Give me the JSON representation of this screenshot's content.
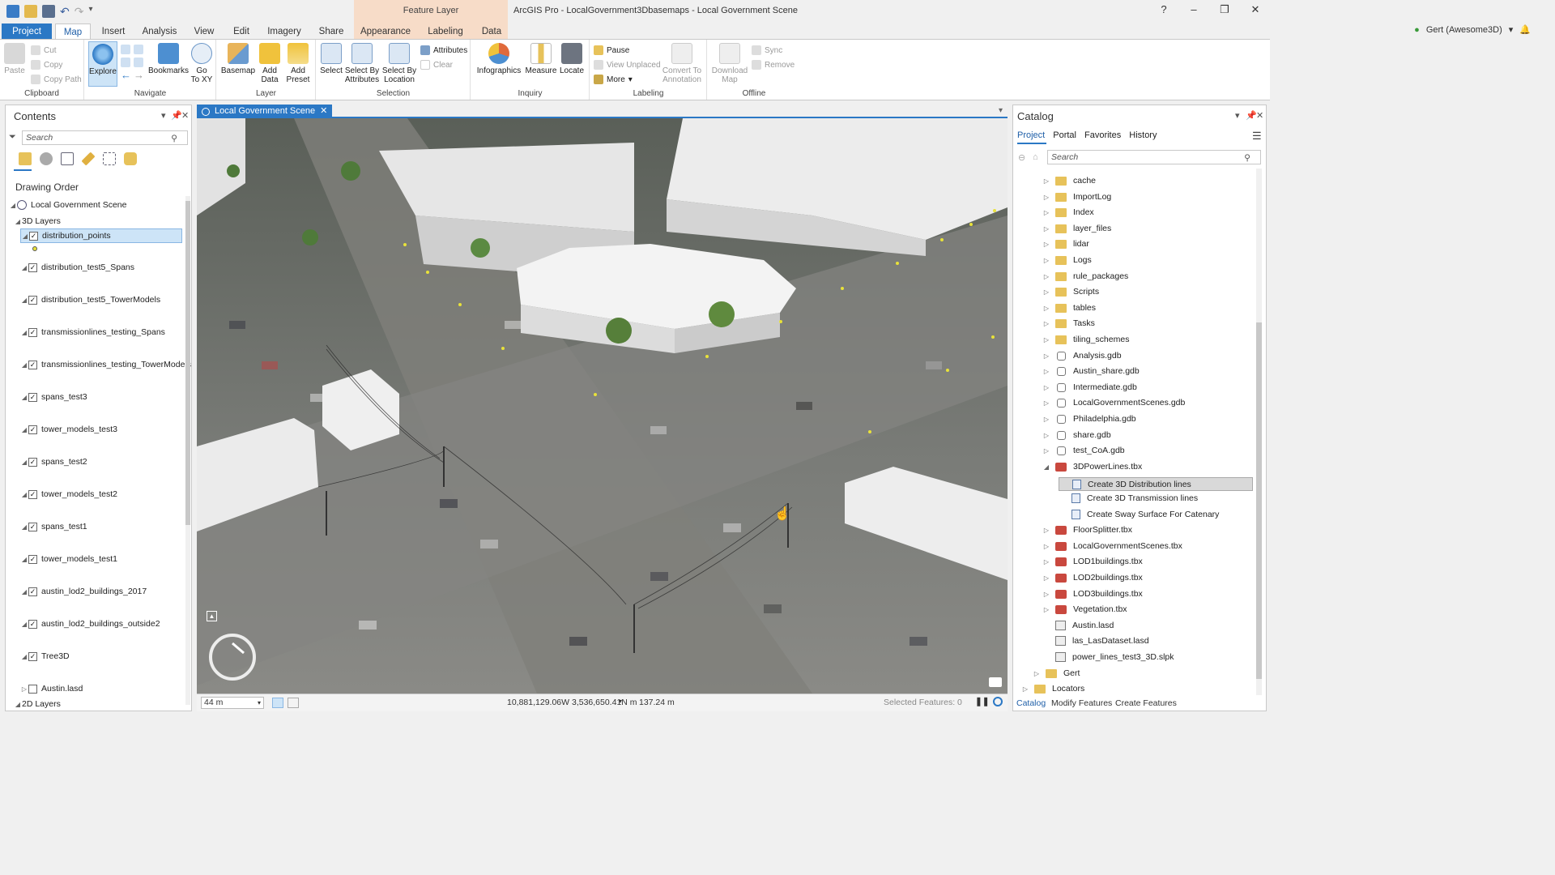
{
  "window": {
    "title": "ArcGIS Pro - LocalGovernment3Dbasemaps - Local Government Scene",
    "contextual_tab_group": "Feature Layer",
    "help": "?",
    "minimize": "–",
    "restore": "❐",
    "close": "✕"
  },
  "ribbon_tabs": [
    "Project",
    "Map",
    "Insert",
    "Analysis",
    "View",
    "Edit",
    "Imagery",
    "Share",
    "Appearance",
    "Labeling",
    "Data"
  ],
  "user": {
    "name": "Gert (Awesome3D)",
    "dropdown": "▾"
  },
  "ribbon": {
    "clipboard": {
      "label": "Clipboard",
      "paste": "Paste",
      "cut": "Cut",
      "copy": "Copy",
      "copy_path": "Copy Path"
    },
    "navigate": {
      "label": "Navigate",
      "explore": "Explore",
      "bookmarks": "Bookmarks",
      "go_to_xy_1": "Go",
      "go_to_xy_2": "To XY"
    },
    "layer": {
      "label": "Layer",
      "basemap": "Basemap",
      "add_data_1": "Add",
      "add_data_2": "Data",
      "add_preset_1": "Add",
      "add_preset_2": "Preset"
    },
    "selection": {
      "label": "Selection",
      "select": "Select",
      "select_by_attributes_1": "Select By",
      "select_by_attributes_2": "Attributes",
      "select_by_location_1": "Select By",
      "select_by_location_2": "Location",
      "attributes": "Attributes",
      "clear": "Clear"
    },
    "inquiry": {
      "label": "Inquiry",
      "infographics": "Infographics",
      "measure": "Measure",
      "locate": "Locate"
    },
    "labeling": {
      "label": "Labeling",
      "pause": "Pause",
      "view_unplaced": "View Unplaced",
      "more": "More",
      "convert_1": "Convert To",
      "convert_2": "Annotation"
    },
    "offline": {
      "label": "Offline",
      "download_1": "Download",
      "download_2": "Map",
      "sync": "Sync",
      "remove": "Remove"
    }
  },
  "contents": {
    "title": "Contents",
    "search_placeholder": "Search",
    "drawing_order": "Drawing Order",
    "scene": "Local Government Scene",
    "group_3d": "3D Layers",
    "layers": [
      "distribution_points",
      "distribution_test5_Spans",
      "distribution_test5_TowerModels",
      "transmissionlines_testing_Spans",
      "transmissionlines_testing_TowerModels",
      "spans_test3",
      "tower_models_test3",
      "spans_test2",
      "tower_models_test2",
      "spans_test1",
      "tower_models_test1",
      "austin_lod2_buildings_2017",
      "austin_lod2_buildings_outside2",
      "Tree3D",
      "Austin.lasd"
    ],
    "group_2d": "2D Layers"
  },
  "map": {
    "tab_label": "Local Government Scene",
    "scale": "44 m",
    "coordinates": "10,881,129.06W 3,536,650.41N m",
    "elevation": "137.24 m",
    "selected_features": "Selected Features: 0"
  },
  "catalog": {
    "title": "Catalog",
    "tabs": [
      "Project",
      "Portal",
      "Favorites",
      "History"
    ],
    "search_placeholder": "Search",
    "items": [
      {
        "label": "cache",
        "kind": "folder"
      },
      {
        "label": "ImportLog",
        "kind": "folder"
      },
      {
        "label": "Index",
        "kind": "folder"
      },
      {
        "label": "layer_files",
        "kind": "folder"
      },
      {
        "label": "lidar",
        "kind": "folder"
      },
      {
        "label": "Logs",
        "kind": "folder"
      },
      {
        "label": "rule_packages",
        "kind": "folder"
      },
      {
        "label": "Scripts",
        "kind": "folder"
      },
      {
        "label": "tables",
        "kind": "folder"
      },
      {
        "label": "Tasks",
        "kind": "folder"
      },
      {
        "label": "tiling_schemes",
        "kind": "folder"
      },
      {
        "label": "Analysis.gdb",
        "kind": "gdb"
      },
      {
        "label": "Austin_share.gdb",
        "kind": "gdb"
      },
      {
        "label": "Intermediate.gdb",
        "kind": "gdb"
      },
      {
        "label": "LocalGovernmentScenes.gdb",
        "kind": "gdb"
      },
      {
        "label": "Philadelphia.gdb",
        "kind": "gdb"
      },
      {
        "label": "share.gdb",
        "kind": "gdb"
      },
      {
        "label": "test_CoA.gdb",
        "kind": "gdb"
      },
      {
        "label": "3DPowerLines.tbx",
        "kind": "tbx-open"
      },
      {
        "label": "Create 3D Distribution lines",
        "kind": "tool-selected"
      },
      {
        "label": "Create 3D Transmission lines",
        "kind": "tool"
      },
      {
        "label": "Create Sway Surface For Catenary",
        "kind": "tool"
      },
      {
        "label": "FloorSplitter.tbx",
        "kind": "tbx"
      },
      {
        "label": "LocalGovernmentScenes.tbx",
        "kind": "tbx"
      },
      {
        "label": "LOD1buildings.tbx",
        "kind": "tbx"
      },
      {
        "label": "LOD2buildings.tbx",
        "kind": "tbx"
      },
      {
        "label": "LOD3buildings.tbx",
        "kind": "tbx"
      },
      {
        "label": "Vegetation.tbx",
        "kind": "tbx"
      },
      {
        "label": "Austin.lasd",
        "kind": "lasd"
      },
      {
        "label": "las_LasDataset.lasd",
        "kind": "lasd"
      },
      {
        "label": "power_lines_test3_3D.slpk",
        "kind": "slpk"
      },
      {
        "label": "Gert",
        "kind": "folder-top"
      },
      {
        "label": "Locators",
        "kind": "locators"
      }
    ],
    "bottom_tabs": [
      "Catalog",
      "Modify Features",
      "Create Features"
    ]
  },
  "colors": {
    "accent": "#2b78c5",
    "contextual": "#f7dcc8",
    "selection": "#cde4f7"
  }
}
